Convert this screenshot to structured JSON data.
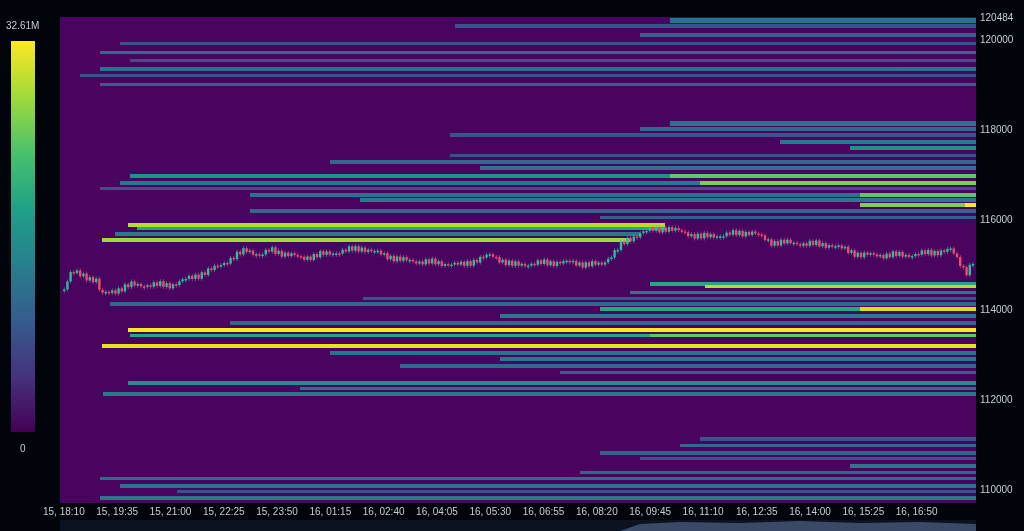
{
  "color_scale": {
    "max_label": "32.61M",
    "min_label": "0"
  },
  "y_axis": {
    "labels": [
      "120484",
      "120000",
      "118000",
      "116000",
      "114000",
      "112000",
      "110000"
    ]
  },
  "x_axis": {
    "labels": [
      "15, 18:10",
      "15, 19:35",
      "15, 21:00",
      "15, 22:25",
      "15, 23:50",
      "16, 01:15",
      "16, 02:40",
      "16, 04:05",
      "16, 05:30",
      "16, 06:55",
      "16, 08:20",
      "16, 09:45",
      "16, 11:10",
      "16, 12:35",
      "16, 14:00",
      "16, 15:25",
      "16, 16:50"
    ]
  }
}
